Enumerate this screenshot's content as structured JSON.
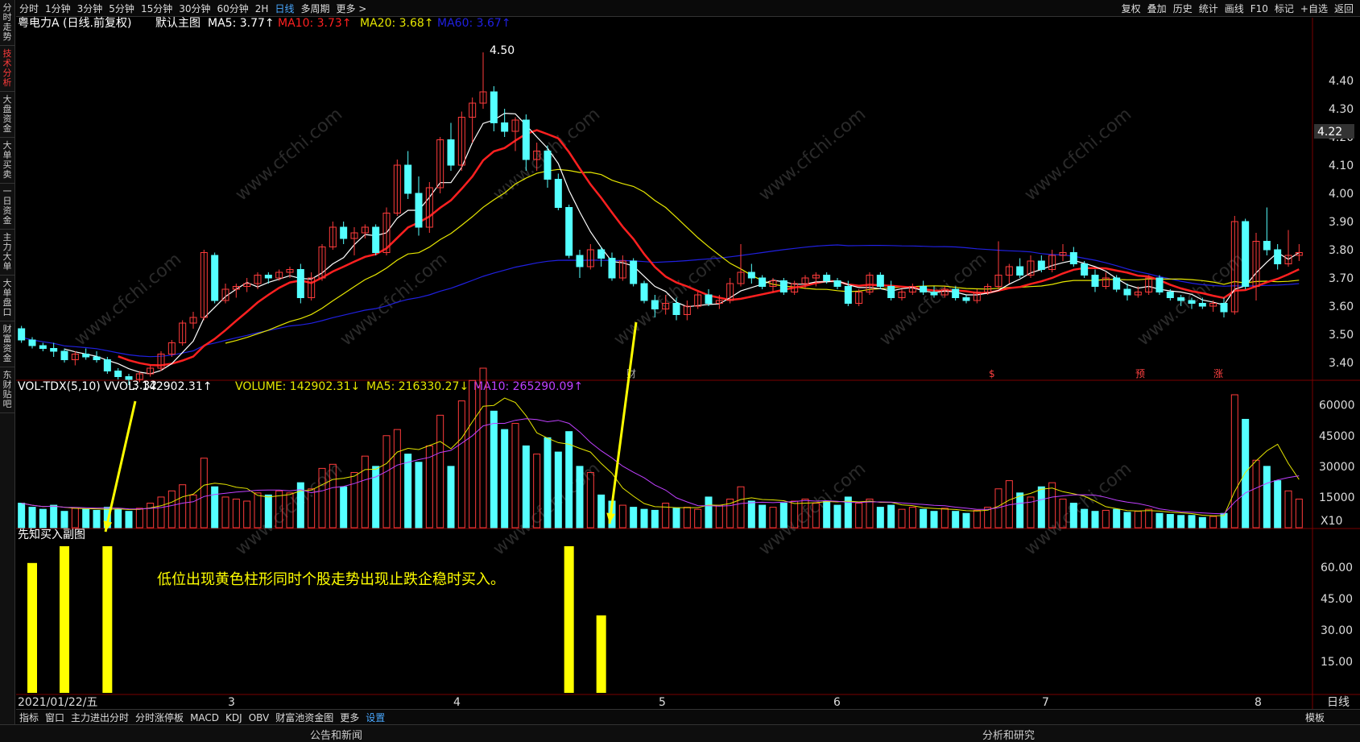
{
  "toolbar": {
    "left": [
      "分时",
      "1分钟",
      "3分钟",
      "5分钟",
      "15分钟",
      "30分钟",
      "60分钟",
      "2H",
      "日线",
      "多周期",
      "更多 >"
    ],
    "active": "日线",
    "right": [
      "复权",
      "叠加",
      "历史",
      "统计",
      "画线",
      "F10",
      "标记",
      "+自选",
      "返回"
    ]
  },
  "sidebar": [
    "分时走势",
    "技术分析",
    "大盘资金",
    "大单买卖",
    "一日资金",
    "主力大单",
    "大单盘口",
    "财富资金",
    "东财贴吧"
  ],
  "sidebar_active": "技术分析",
  "main_header": {
    "title": "粤电力A (日线.前复权)",
    "template": "默认主图",
    "ma5": "MA5: 3.77↑",
    "ma10": "MA10: 3.73↑",
    "ma20": "MA20: 3.68↑",
    "ma60": "MA60: 3.67↑"
  },
  "vol_header": {
    "name": "VOL-TDX(5,10) VVOL: 142902.31↑",
    "volume": "VOLUME: 142902.31↓",
    "ma5": "MA5: 216330.27↓",
    "ma10": "MA10: 265290.09↑"
  },
  "sub_header": "先知买入副图",
  "annotation": "低位出现黄色柱形同时个股走势出现止跌企稳时买入。",
  "price_axis": [
    "4.40",
    "4.30",
    "4.20",
    "4.10",
    "4.00",
    "3.90",
    "3.80",
    "3.70",
    "3.60",
    "3.50",
    "3.40"
  ],
  "current_price": "4.22",
  "high_label": "4.50",
  "low_label": "3.32",
  "vol_axis": [
    "60000",
    "45000",
    "30000",
    "15000"
  ],
  "vol_unit": "X10",
  "sub_axis": [
    "60.00",
    "45.00",
    "30.00",
    "15.00"
  ],
  "x_labels": [
    "2021/01/22/五",
    "3",
    "4",
    "5",
    "6",
    "7",
    "8"
  ],
  "period_label": "日线",
  "event_marks": [
    "财",
    "$",
    "预",
    "涨"
  ],
  "bottom_tabs": [
    "指标",
    "窗口",
    "主力进出分时",
    "分时涨停板",
    "MACD",
    "KDJ",
    "OBV",
    "财富池资金图",
    "更多",
    "设置"
  ],
  "bottom_active": "设置",
  "bottom_right": "模板",
  "status": [
    "公告和新闻",
    "分析和研究"
  ],
  "watermark": "www.cfchi.com",
  "colors": {
    "up": "#ff3b3b",
    "down": "#54ffff",
    "ma5": "#ffffff",
    "ma10": "#ff2020",
    "ma20": "#e6e600",
    "ma60": "#2020e0",
    "signal": "#ffff00"
  },
  "chart_data": {
    "type": "candlestick",
    "ylim": [
      3.3,
      4.5
    ],
    "candles": [
      [
        3.52,
        3.53,
        3.47,
        3.48
      ],
      [
        3.48,
        3.49,
        3.45,
        3.46
      ],
      [
        3.46,
        3.47,
        3.44,
        3.45
      ],
      [
        3.45,
        3.47,
        3.42,
        3.44
      ],
      [
        3.44,
        3.45,
        3.4,
        3.41
      ],
      [
        3.41,
        3.44,
        3.39,
        3.43
      ],
      [
        3.43,
        3.45,
        3.41,
        3.42
      ],
      [
        3.42,
        3.44,
        3.4,
        3.41
      ],
      [
        3.41,
        3.42,
        3.36,
        3.37
      ],
      [
        3.37,
        3.38,
        3.34,
        3.35
      ],
      [
        3.35,
        3.36,
        3.32,
        3.34
      ],
      [
        3.34,
        3.37,
        3.33,
        3.36
      ],
      [
        3.36,
        3.39,
        3.35,
        3.38
      ],
      [
        3.38,
        3.44,
        3.37,
        3.43
      ],
      [
        3.43,
        3.48,
        3.42,
        3.47
      ],
      [
        3.47,
        3.55,
        3.46,
        3.54
      ],
      [
        3.54,
        3.58,
        3.52,
        3.56
      ],
      [
        3.56,
        3.8,
        3.55,
        3.79
      ],
      [
        3.78,
        3.79,
        3.61,
        3.62
      ],
      [
        3.62,
        3.68,
        3.61,
        3.66
      ],
      [
        3.66,
        3.68,
        3.63,
        3.67
      ],
      [
        3.67,
        3.7,
        3.65,
        3.68
      ],
      [
        3.68,
        3.72,
        3.66,
        3.71
      ],
      [
        3.71,
        3.72,
        3.68,
        3.7
      ],
      [
        3.7,
        3.73,
        3.69,
        3.72
      ],
      [
        3.72,
        3.74,
        3.7,
        3.73
      ],
      [
        3.73,
        3.75,
        3.61,
        3.63
      ],
      [
        3.63,
        3.72,
        3.62,
        3.7
      ],
      [
        3.7,
        3.82,
        3.69,
        3.81
      ],
      [
        3.81,
        3.9,
        3.8,
        3.88
      ],
      [
        3.88,
        3.9,
        3.82,
        3.84
      ],
      [
        3.84,
        3.88,
        3.78,
        3.86
      ],
      [
        3.86,
        3.89,
        3.84,
        3.88
      ],
      [
        3.88,
        3.89,
        3.78,
        3.79
      ],
      [
        3.79,
        3.95,
        3.78,
        3.93
      ],
      [
        3.93,
        4.12,
        3.92,
        4.1
      ],
      [
        4.1,
        4.15,
        3.98,
        4.0
      ],
      [
        4.0,
        4.06,
        3.85,
        3.88
      ],
      [
        3.88,
        4.04,
        3.86,
        4.02
      ],
      [
        4.02,
        4.2,
        4.0,
        4.19
      ],
      [
        4.19,
        4.25,
        4.08,
        4.1
      ],
      [
        4.1,
        4.29,
        4.08,
        4.27
      ],
      [
        4.27,
        4.34,
        4.18,
        4.32
      ],
      [
        4.32,
        4.5,
        4.3,
        4.36
      ],
      [
        4.36,
        4.38,
        4.22,
        4.25
      ],
      [
        4.25,
        4.3,
        4.2,
        4.22
      ],
      [
        4.22,
        4.27,
        4.15,
        4.26
      ],
      [
        4.26,
        4.28,
        4.08,
        4.12
      ],
      [
        4.12,
        4.18,
        4.08,
        4.15
      ],
      [
        4.15,
        4.17,
        4.02,
        4.05
      ],
      [
        4.05,
        4.07,
        3.94,
        3.95
      ],
      [
        3.95,
        3.96,
        3.77,
        3.78
      ],
      [
        3.78,
        3.8,
        3.7,
        3.74
      ],
      [
        3.74,
        3.82,
        3.73,
        3.8
      ],
      [
        3.8,
        3.81,
        3.74,
        3.77
      ],
      [
        3.77,
        3.79,
        3.69,
        3.7
      ],
      [
        3.7,
        3.78,
        3.69,
        3.76
      ],
      [
        3.76,
        3.77,
        3.67,
        3.68
      ],
      [
        3.68,
        3.69,
        3.61,
        3.62
      ],
      [
        3.62,
        3.64,
        3.56,
        3.59
      ],
      [
        3.59,
        3.64,
        3.57,
        3.61
      ],
      [
        3.61,
        3.63,
        3.55,
        3.57
      ],
      [
        3.57,
        3.62,
        3.55,
        3.6
      ],
      [
        3.6,
        3.65,
        3.59,
        3.64
      ],
      [
        3.64,
        3.66,
        3.6,
        3.61
      ],
      [
        3.61,
        3.64,
        3.59,
        3.62
      ],
      [
        3.62,
        3.7,
        3.61,
        3.68
      ],
      [
        3.68,
        3.82,
        3.67,
        3.72
      ],
      [
        3.72,
        3.75,
        3.68,
        3.7
      ],
      [
        3.7,
        3.71,
        3.66,
        3.67
      ],
      [
        3.67,
        3.7,
        3.65,
        3.69
      ],
      [
        3.69,
        3.7,
        3.64,
        3.65
      ],
      [
        3.65,
        3.69,
        3.64,
        3.68
      ],
      [
        3.68,
        3.71,
        3.66,
        3.7
      ],
      [
        3.7,
        3.72,
        3.67,
        3.71
      ],
      [
        3.71,
        3.72,
        3.68,
        3.69
      ],
      [
        3.69,
        3.7,
        3.66,
        3.67
      ],
      [
        3.67,
        3.69,
        3.6,
        3.61
      ],
      [
        3.61,
        3.66,
        3.6,
        3.65
      ],
      [
        3.65,
        3.72,
        3.64,
        3.71
      ],
      [
        3.71,
        3.72,
        3.66,
        3.67
      ],
      [
        3.67,
        3.69,
        3.62,
        3.63
      ],
      [
        3.63,
        3.66,
        3.62,
        3.65
      ],
      [
        3.65,
        3.68,
        3.64,
        3.67
      ],
      [
        3.67,
        3.69,
        3.64,
        3.65
      ],
      [
        3.65,
        3.67,
        3.63,
        3.64
      ],
      [
        3.64,
        3.67,
        3.63,
        3.66
      ],
      [
        3.66,
        3.67,
        3.62,
        3.63
      ],
      [
        3.63,
        3.64,
        3.61,
        3.62
      ],
      [
        3.62,
        3.66,
        3.61,
        3.65
      ],
      [
        3.65,
        3.68,
        3.64,
        3.67
      ],
      [
        3.67,
        3.83,
        3.66,
        3.71
      ],
      [
        3.71,
        3.75,
        3.68,
        3.74
      ],
      [
        3.74,
        3.77,
        3.7,
        3.71
      ],
      [
        3.71,
        3.78,
        3.7,
        3.76
      ],
      [
        3.76,
        3.78,
        3.72,
        3.73
      ],
      [
        3.73,
        3.8,
        3.72,
        3.78
      ],
      [
        3.78,
        3.82,
        3.76,
        3.79
      ],
      [
        3.79,
        3.81,
        3.74,
        3.75
      ],
      [
        3.75,
        3.76,
        3.7,
        3.71
      ],
      [
        3.71,
        3.73,
        3.65,
        3.67
      ],
      [
        3.67,
        3.72,
        3.66,
        3.7
      ],
      [
        3.7,
        3.71,
        3.65,
        3.66
      ],
      [
        3.66,
        3.68,
        3.62,
        3.64
      ],
      [
        3.64,
        3.67,
        3.63,
        3.65
      ],
      [
        3.65,
        3.71,
        3.64,
        3.7
      ],
      [
        3.7,
        3.71,
        3.64,
        3.65
      ],
      [
        3.65,
        3.66,
        3.62,
        3.63
      ],
      [
        3.63,
        3.64,
        3.6,
        3.62
      ],
      [
        3.62,
        3.63,
        3.59,
        3.61
      ],
      [
        3.61,
        3.63,
        3.59,
        3.6
      ],
      [
        3.6,
        3.62,
        3.58,
        3.61
      ],
      [
        3.61,
        3.63,
        3.56,
        3.58
      ],
      [
        3.58,
        3.92,
        3.57,
        3.9
      ],
      [
        3.9,
        3.91,
        3.66,
        3.67
      ],
      [
        3.67,
        3.86,
        3.62,
        3.83
      ],
      [
        3.83,
        3.95,
        3.78,
        3.8
      ],
      [
        3.8,
        3.82,
        3.73,
        3.75
      ],
      [
        3.75,
        3.87,
        3.74,
        3.78
      ],
      [
        3.78,
        3.82,
        3.76,
        3.79
      ]
    ],
    "volume": [
      12000,
      10000,
      9000,
      11000,
      8000,
      9500,
      9000,
      8500,
      10000,
      9000,
      8000,
      9500,
      12000,
      15000,
      18000,
      21000,
      16000,
      34000,
      20000,
      15000,
      14000,
      13000,
      17000,
      16000,
      18000,
      17000,
      22000,
      19000,
      29000,
      31000,
      20000,
      27000,
      35000,
      30000,
      45000,
      48000,
      36000,
      32000,
      40000,
      55000,
      30000,
      62000,
      72000,
      78000,
      57000,
      48000,
      51000,
      40000,
      36000,
      44000,
      37000,
      47000,
      30000,
      27000,
      16000,
      13000,
      11000,
      10000,
      9000,
      8500,
      12000,
      9500,
      10000,
      9000,
      15000,
      11000,
      14000,
      20000,
      13000,
      11000,
      10000,
      12000,
      13000,
      14000,
      12000,
      13000,
      11000,
      15000,
      12000,
      14000,
      10000,
      11000,
      9000,
      10000,
      9000,
      8000,
      9500,
      8000,
      7000,
      8500,
      10000,
      19000,
      23000,
      17000,
      15000,
      20000,
      22000,
      14000,
      12000,
      9000,
      8000,
      8500,
      9000,
      7500,
      8000,
      9000,
      7000,
      6500,
      6000,
      6000,
      5000,
      5500,
      7000,
      65000,
      53000,
      33000,
      30000,
      23000,
      18000,
      14000
    ],
    "vol_ylim": [
      0,
      65000
    ],
    "signal": [
      {
        "index": 1,
        "value": 62
      },
      {
        "index": 4,
        "value": 70
      },
      {
        "index": 8,
        "value": 70
      },
      {
        "index": 51,
        "value": 70
      },
      {
        "index": 54,
        "value": 37
      }
    ],
    "signal_ylim": [
      0,
      75
    ]
  }
}
